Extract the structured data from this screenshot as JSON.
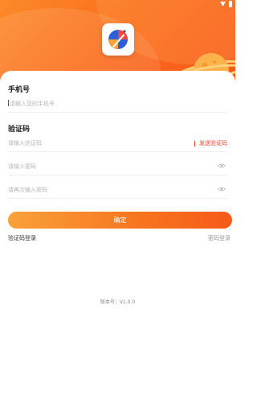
{
  "form": {
    "phone_label": "手机号",
    "phone_placeholder": "请输入您的手机号",
    "code_label": "验证码",
    "code_placeholder": "请输入验证码",
    "send_code": "发送验证码",
    "password_placeholder": "请输入密码",
    "confirm_password_placeholder": "请再次输入密码",
    "confirm_button": "确定"
  },
  "links": {
    "code_login": "验证码登录",
    "password_login": "密码登录"
  },
  "footer": {
    "version": "版本号：V1.0.0"
  },
  "icons": {
    "app_logo": "rocket-logo-icon",
    "planet": "planet-icon",
    "eye": "eye-icon"
  },
  "colors": {
    "accent": "#f7741f",
    "send_code": "#e8452c"
  }
}
